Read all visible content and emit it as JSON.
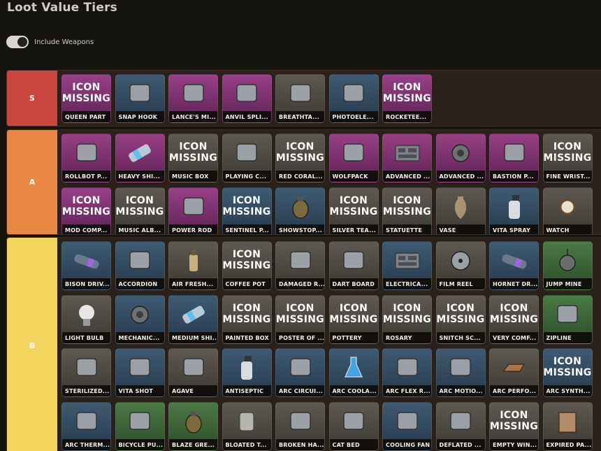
{
  "page": {
    "title": "Loot Value Tiers"
  },
  "settings": {
    "include_weapons_label": "Include Weapons",
    "include_weapons_on": true
  },
  "tiers": [
    {
      "label": "S",
      "color": "#c9463d",
      "items": [
        {
          "name": "QUEEN PART",
          "rarity": "epic",
          "missing": true
        },
        {
          "name": "SNAP HOOK",
          "rarity": "rare",
          "icon": "snap-hook-icon"
        },
        {
          "name": "LANCE'S MI...",
          "rarity": "epic",
          "icon": "cassette-icon"
        },
        {
          "name": "ANVIL SPLI...",
          "rarity": "epic",
          "icon": "canister-icon"
        },
        {
          "name": "BREATHTA...",
          "rarity": "common",
          "icon": "snow-globe-icon"
        },
        {
          "name": "PHOTOELE...",
          "rarity": "rare",
          "icon": "cable-icon"
        },
        {
          "name": "ROCKETEE...",
          "rarity": "epic",
          "missing": true
        }
      ]
    },
    {
      "label": "A",
      "color": "#e98845",
      "items": [
        {
          "name": "ROLLBOT P...",
          "rarity": "epic",
          "icon": "rollbot-icon"
        },
        {
          "name": "HEAVY SHI...",
          "rarity": "epic",
          "icon": "battery-cell-icon"
        },
        {
          "name": "MUSIC BOX",
          "rarity": "common",
          "missing": true
        },
        {
          "name": "PLAYING C...",
          "rarity": "common",
          "icon": "card-stack-icon"
        },
        {
          "name": "RED CORAL...",
          "rarity": "common",
          "missing": true
        },
        {
          "name": "WOLFPACK",
          "rarity": "epic",
          "icon": "wolfpack-icon"
        },
        {
          "name": "ADVANCED ...",
          "rarity": "epic",
          "icon": "circuit-board-icon"
        },
        {
          "name": "ADVANCED ...",
          "rarity": "epic",
          "icon": "mechanical-part-icon"
        },
        {
          "name": "BASTION P...",
          "rarity": "epic",
          "icon": "cylinder-icon"
        },
        {
          "name": "FINE WRIST...",
          "rarity": "common",
          "missing": true
        },
        {
          "name": "MOD COMP...",
          "rarity": "epic",
          "missing": true
        },
        {
          "name": "MUSIC ALB...",
          "rarity": "common",
          "missing": true
        },
        {
          "name": "POWER ROD",
          "rarity": "epic",
          "icon": "power-rod-icon"
        },
        {
          "name": "SENTINEL P...",
          "rarity": "rare",
          "missing": true
        },
        {
          "name": "SHOWSTOP...",
          "rarity": "rare",
          "icon": "grenade-icon"
        },
        {
          "name": "SILVER TEA...",
          "rarity": "common",
          "missing": true
        },
        {
          "name": "STATUETTE",
          "rarity": "common",
          "missing": true
        },
        {
          "name": "VASE",
          "rarity": "common",
          "icon": "vase-icon"
        },
        {
          "name": "VITA SPRAY",
          "rarity": "rare",
          "icon": "spray-bottle-icon"
        },
        {
          "name": "WATCH",
          "rarity": "common",
          "icon": "watch-icon"
        }
      ]
    },
    {
      "label": "B",
      "color": "#f4d35e",
      "items": [
        {
          "name": "BISON DRIV...",
          "rarity": "rare",
          "icon": "driver-icon"
        },
        {
          "name": "ACCORDION",
          "rarity": "rare",
          "icon": "accordion-icon"
        },
        {
          "name": "AIR FRESH...",
          "rarity": "common",
          "icon": "bottle-icon"
        },
        {
          "name": "COFFEE POT",
          "rarity": "common",
          "missing": true
        },
        {
          "name": "DAMAGED R...",
          "rarity": "common",
          "icon": "drone-icon"
        },
        {
          "name": "DART BOARD",
          "rarity": "common",
          "icon": "dart-board-icon"
        },
        {
          "name": "ELECTRICA...",
          "rarity": "rare",
          "icon": "circuit-board-icon"
        },
        {
          "name": "FILM REEL",
          "rarity": "common",
          "icon": "film-reel-icon"
        },
        {
          "name": "HORNET DR...",
          "rarity": "rare",
          "icon": "driver-icon"
        },
        {
          "name": "JUMP MINE",
          "rarity": "uncommon",
          "icon": "mine-icon"
        },
        {
          "name": "LIGHT BULB",
          "rarity": "common",
          "icon": "light-bulb-icon"
        },
        {
          "name": "MECHANIC...",
          "rarity": "rare",
          "icon": "mechanical-part-icon"
        },
        {
          "name": "MEDIUM SHI...",
          "rarity": "rare",
          "icon": "battery-cell-icon"
        },
        {
          "name": "PAINTED BOX",
          "rarity": "common",
          "missing": true
        },
        {
          "name": "POSTER OF ...",
          "rarity": "common",
          "missing": true
        },
        {
          "name": "POTTERY",
          "rarity": "common",
          "missing": true
        },
        {
          "name": "ROSARY",
          "rarity": "common",
          "missing": true
        },
        {
          "name": "SNITCH SC...",
          "rarity": "common",
          "missing": true
        },
        {
          "name": "VERY COMF...",
          "rarity": "common",
          "missing": true
        },
        {
          "name": "ZIPLINE",
          "rarity": "uncommon",
          "icon": "zipline-icon"
        },
        {
          "name": "STERILIZED...",
          "rarity": "common",
          "icon": "bandage-icon"
        },
        {
          "name": "VITA SHOT",
          "rarity": "rare",
          "icon": "syringe-icon"
        },
        {
          "name": "AGAVE",
          "rarity": "common",
          "icon": "agave-icon"
        },
        {
          "name": "ANTISEPTIC",
          "rarity": "rare",
          "icon": "spray-bottle-icon"
        },
        {
          "name": "ARC CIRCUI...",
          "rarity": "rare",
          "icon": "circuit-disc-icon"
        },
        {
          "name": "ARC COOLA...",
          "rarity": "rare",
          "icon": "flask-icon"
        },
        {
          "name": "ARC FLEX R...",
          "rarity": "rare",
          "icon": "rubber-coil-icon"
        },
        {
          "name": "ARC MOTIO...",
          "rarity": "rare",
          "icon": "motion-core-icon"
        },
        {
          "name": "ARC PERFO...",
          "rarity": "common",
          "icon": "ingot-icon"
        },
        {
          "name": "ARC SYNTH...",
          "rarity": "rare",
          "missing": true
        },
        {
          "name": "ARC THERM...",
          "rarity": "rare",
          "icon": "thermal-foil-icon"
        },
        {
          "name": "BICYCLE PU...",
          "rarity": "uncommon",
          "icon": "bicycle-pump-icon"
        },
        {
          "name": "BLAZE GRE...",
          "rarity": "uncommon",
          "icon": "grenade-icon"
        },
        {
          "name": "BLOATED T...",
          "rarity": "common",
          "icon": "tin-can-icon"
        },
        {
          "name": "BROKEN HA...",
          "rarity": "common",
          "icon": "handheld-device-icon"
        },
        {
          "name": "CAT BED",
          "rarity": "common",
          "icon": "cat-bed-icon"
        },
        {
          "name": "COOLING FAN",
          "rarity": "rare",
          "icon": "cooling-fan-icon"
        },
        {
          "name": "DEFLATED ...",
          "rarity": "common",
          "icon": "deflated-ball-icon"
        },
        {
          "name": "EMPTY WIN...",
          "rarity": "common",
          "missing": true
        },
        {
          "name": "EXPIRED PA...",
          "rarity": "common",
          "icon": "package-icon"
        }
      ]
    }
  ],
  "icon_missing_line1": "ICON",
  "icon_missing_line2": "MISSING"
}
